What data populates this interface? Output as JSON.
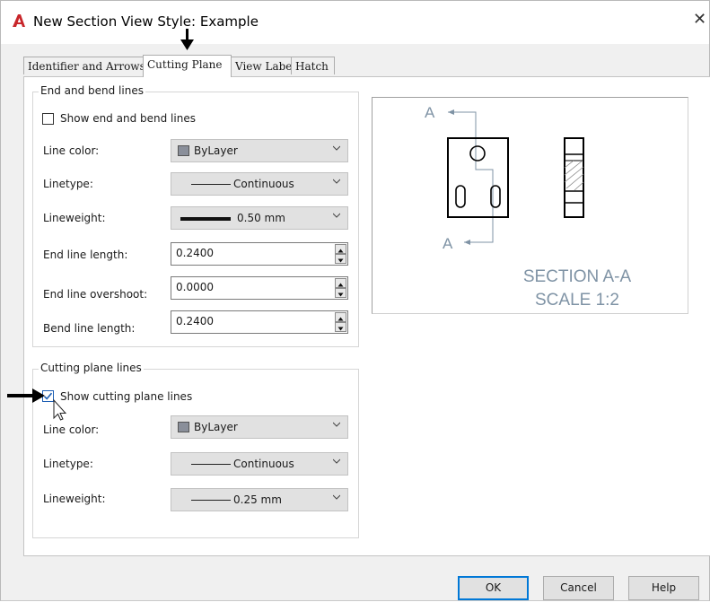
{
  "window": {
    "title": "New Section View Style: Example",
    "close_glyph": "✕",
    "app_icon": "autocad-a-icon"
  },
  "tabs": [
    {
      "label": "Identifier and Arrows",
      "active": false
    },
    {
      "label": "Cutting Plane",
      "active": true
    },
    {
      "label": "View Label",
      "active": false
    },
    {
      "label": "Hatch",
      "active": false
    }
  ],
  "end_bend_group": {
    "legend": "End and bend lines",
    "show_checkbox": {
      "label": "Show end and bend lines",
      "checked": false
    },
    "line_color": {
      "label": "Line color:",
      "value": "ByLayer"
    },
    "linetype": {
      "label": "Linetype:",
      "value": "Continuous"
    },
    "lineweight": {
      "label": "Lineweight:",
      "value": "0.50 mm"
    },
    "end_line_length": {
      "label": "End line length:",
      "value": "0.2400"
    },
    "end_line_overshoot": {
      "label": "End line overshoot:",
      "value": "0.0000"
    },
    "bend_line_length": {
      "label": "Bend line length:",
      "value": "0.2400"
    }
  },
  "cutting_group": {
    "legend": "Cutting plane lines",
    "show_checkbox": {
      "label": "Show cutting plane lines",
      "checked": true
    },
    "line_color": {
      "label": "Line color:",
      "value": "ByLayer"
    },
    "linetype": {
      "label": "Linetype:",
      "value": "Continuous"
    },
    "lineweight": {
      "label": "Lineweight:",
      "value": "0.25 mm"
    }
  },
  "preview": {
    "identifier": "A",
    "section_title": "SECTION A-A",
    "scale_text": "SCALE 1:2",
    "label_color": "#7f93a5"
  },
  "buttons": {
    "ok": "OK",
    "cancel": "Cancel",
    "help": "Help"
  },
  "colors": {
    "accent_blue": "#0078d7",
    "checkbox_blue": "#1e5fb4",
    "app_icon_red": "#c8262a"
  }
}
